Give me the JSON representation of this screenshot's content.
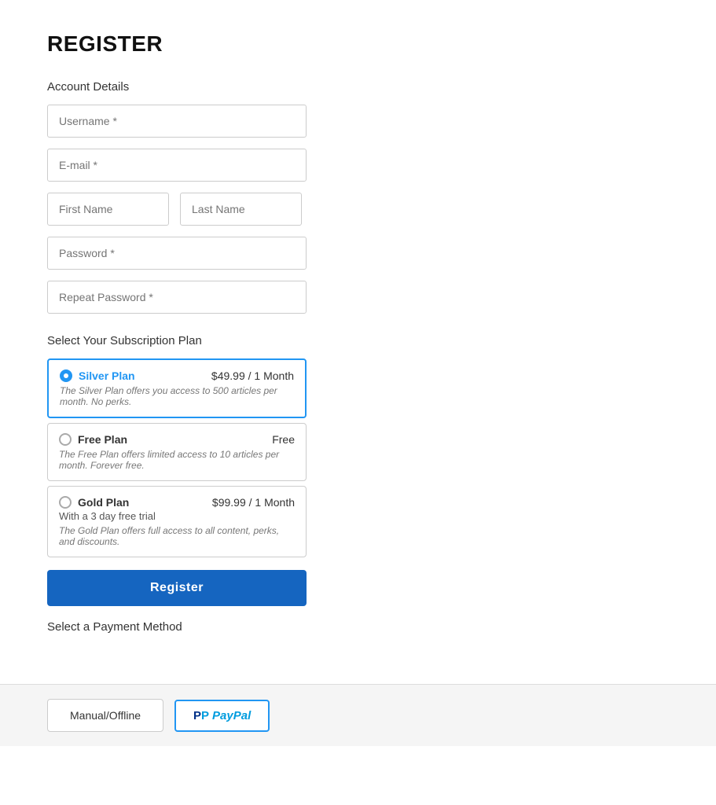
{
  "page": {
    "title": "REGISTER"
  },
  "account_details": {
    "label": "Account Details",
    "username_placeholder": "Username *",
    "email_placeholder": "E-mail *",
    "firstname_placeholder": "First Name",
    "lastname_placeholder": "Last Name",
    "password_placeholder": "Password *",
    "repeat_password_placeholder": "Repeat Password *"
  },
  "subscription": {
    "label": "Select Your Subscription Plan",
    "plans": [
      {
        "id": "silver",
        "name": "Silver Plan",
        "price": "$49.99 / 1 Month",
        "description": "The Silver Plan offers you access to 500 articles per month. No perks.",
        "subtitle": "",
        "selected": true
      },
      {
        "id": "free",
        "name": "Free Plan",
        "price": "Free",
        "description": "The Free Plan offers limited access to 10 articles per month. Forever free.",
        "subtitle": "",
        "selected": false
      },
      {
        "id": "gold",
        "name": "Gold Plan",
        "price": "$99.99 / 1 Month",
        "description": "The Gold Plan offers full access to all content, perks, and discounts.",
        "subtitle": "With a 3 day free trial",
        "selected": false
      }
    ],
    "register_button": "Register"
  },
  "payment": {
    "label": "Select a Payment Method",
    "methods": [
      {
        "id": "manual",
        "label": "Manual/Offline"
      },
      {
        "id": "paypal",
        "label": "PayPal"
      }
    ]
  }
}
